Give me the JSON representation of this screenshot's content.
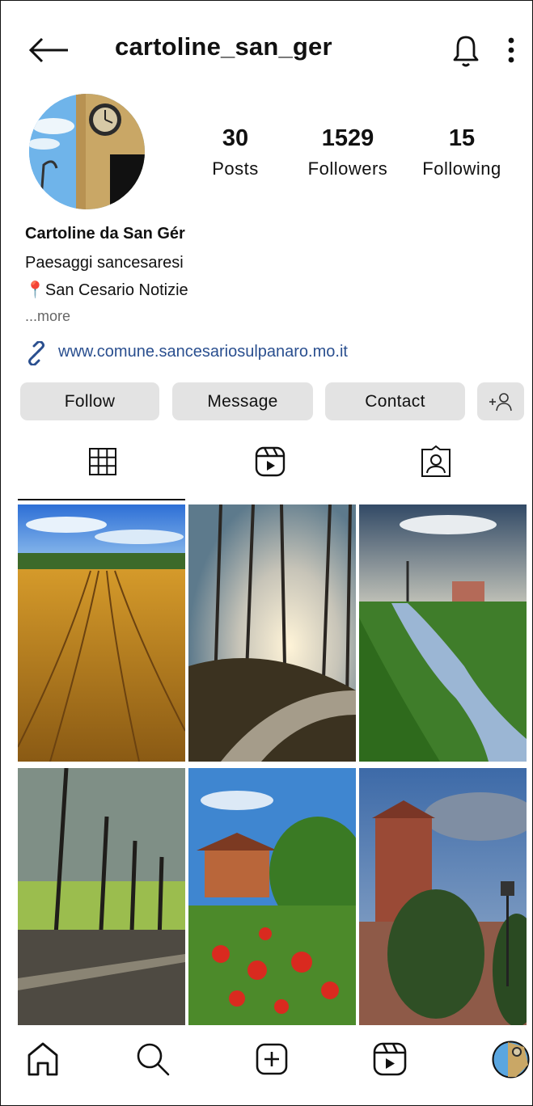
{
  "header": {
    "username": "cartoline_san_ger"
  },
  "profile": {
    "stats": [
      {
        "value": "30",
        "label": "Posts"
      },
      {
        "value": "1529",
        "label": "Followers"
      },
      {
        "value": "15",
        "label": "Following"
      }
    ],
    "display_name": "Cartoline da San Gér",
    "bio_line1": "Paesaggi sancesaresi",
    "bio_line2": "📍San Cesario Notizie",
    "more_label": "...more",
    "website": "www.comune.sancesariosulpanaro.mo.it"
  },
  "actions": {
    "follow": "Follow",
    "message": "Message",
    "contact": "Contact"
  },
  "colors": {
    "link": "#2a4f8f",
    "button_bg": "#e3e3e3",
    "pin": "#e0245e"
  },
  "icons": [
    "back-arrow-icon",
    "bell-icon",
    "more-vertical-icon",
    "link-icon",
    "add-user-icon",
    "grid-icon",
    "reels-icon",
    "tagged-icon",
    "home-icon",
    "search-icon",
    "create-icon",
    "reels-nav-icon"
  ]
}
